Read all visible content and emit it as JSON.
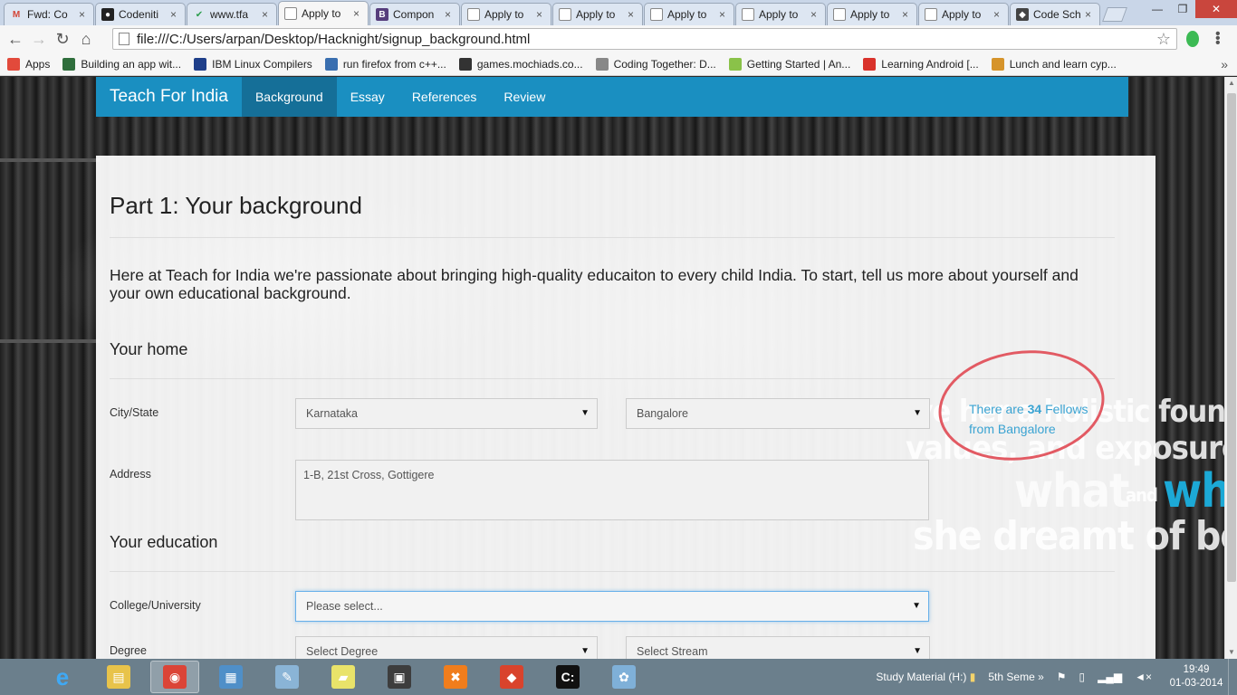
{
  "browser": {
    "tabs": [
      {
        "title": "Fwd: Co",
        "icon": "gmail-icon",
        "color": "#d44638",
        "glyph": "M"
      },
      {
        "title": "Codeniti",
        "icon": "github-icon",
        "color": "#222222",
        "glyph": "●"
      },
      {
        "title": "www.tfa",
        "icon": "check-icon",
        "color": "#2e9e4f",
        "glyph": "✔"
      },
      {
        "title": "Apply to",
        "icon": "page-icon",
        "color": "#ffffff",
        "glyph": "",
        "active": true
      },
      {
        "title": "Compon",
        "icon": "bootstrap-icon",
        "color": "#563d7c",
        "glyph": "B"
      },
      {
        "title": "Apply to",
        "icon": "page-icon",
        "color": "#ffffff",
        "glyph": ""
      },
      {
        "title": "Apply to",
        "icon": "page-icon",
        "color": "#ffffff",
        "glyph": ""
      },
      {
        "title": "Apply to",
        "icon": "page-icon",
        "color": "#ffffff",
        "glyph": ""
      },
      {
        "title": "Apply to",
        "icon": "page-icon",
        "color": "#ffffff",
        "glyph": ""
      },
      {
        "title": "Apply to",
        "icon": "page-icon",
        "color": "#ffffff",
        "glyph": ""
      },
      {
        "title": "Apply to",
        "icon": "page-icon",
        "color": "#ffffff",
        "glyph": ""
      },
      {
        "title": "Code Sch",
        "icon": "codeschool-icon",
        "color": "#444444",
        "glyph": "◆"
      }
    ],
    "url": "file:///C:/Users/arpan/Desktop/Hacknight/signup_background.html",
    "bookmarks": [
      {
        "label": "Apps",
        "icon": "apps-grid-icon",
        "color": "#e24a3b"
      },
      {
        "label": "Building an app wit...",
        "icon": "bookmark-app-icon",
        "color": "#2f6e3c"
      },
      {
        "label": "IBM Linux Compilers",
        "icon": "ibm-icon",
        "color": "#1f3f8a"
      },
      {
        "label": "run firefox from c++...",
        "icon": "bookmark-code-icon",
        "color": "#3a6fb0"
      },
      {
        "label": "games.mochiads.co...",
        "icon": "mochi-icon",
        "color": "#333333"
      },
      {
        "label": "Coding Together: D...",
        "icon": "apple-icon",
        "color": "#888888"
      },
      {
        "label": "Getting Started | An...",
        "icon": "android-icon",
        "color": "#8ac249"
      },
      {
        "label": "Learning Android [...",
        "icon": "pdf-icon",
        "color": "#d9322b"
      },
      {
        "label": "Lunch and learn cyp...",
        "icon": "bookmark-puzzle-icon",
        "color": "#d6942b"
      }
    ]
  },
  "site": {
    "brand": "Teach For India",
    "nav": [
      "Background",
      "Essay",
      "References",
      "Review"
    ],
    "active_nav": "Background",
    "accent": "#1a8fc1",
    "accent_dark": "#156f98"
  },
  "background_text": {
    "line1": "He gave her a holistic foundatio",
    "line2": "values, and exposure to b",
    "line3a": "what",
    "line3b": "and",
    "line3c": "wh",
    "line4": "she dreamt of being"
  },
  "form": {
    "title": "Part 1: Your background",
    "intro": "Here at Teach for India we're passionate about bringing high-quality educaiton to every child India. To start, tell us more about yourself and your own educational background.",
    "home_heading": "Your home",
    "city_label": "City/State",
    "state_value": "Karnataka",
    "city_value": "Bangalore",
    "address_label": "Address",
    "address_value": "1-B, 21st Cross, Gottigere",
    "education_heading": "Your education",
    "college_label": "College/University",
    "college_value": "Please select...",
    "degree_label": "Degree",
    "degree_value": "Select Degree",
    "stream_value": "Select Stream",
    "fellows_pre": "There are",
    "fellows_count": "34",
    "fellows_mid": "Fellows",
    "fellows_post": "from Bangalore",
    "highlight_color": "#e25a63"
  },
  "taskbar": {
    "apps": [
      "ie-icon",
      "explorer-icon",
      "chrome-icon",
      "control-panel-icon",
      "notepad-icon",
      "sticky-notes-icon",
      "vmware-icon",
      "xampp-icon",
      "git-icon",
      "cmd-icon",
      "paint-icon"
    ],
    "tray_drive": "Study Material (H:)",
    "tray_folder": "5th Seme",
    "time": "19:49",
    "date": "01-03-2014"
  }
}
